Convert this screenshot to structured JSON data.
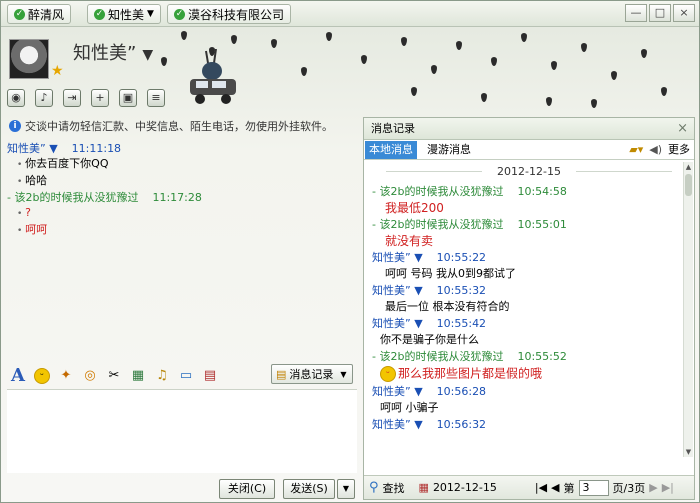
{
  "titlebar": {
    "tabs": [
      "醉清风",
      "知性美",
      "漠谷科技有限公司"
    ],
    "caret": "▼",
    "min": "—",
    "max": "□",
    "close": "×"
  },
  "header": {
    "name": "知性美”",
    "caret": "▼"
  },
  "notice": "交谈中请勿轻信汇款、中奖信息、陌生电话，勿使用外挂软件。",
  "chat": [
    {
      "type": "head",
      "sender": "知性美” ▼",
      "time": "11:11:18",
      "color": "blue"
    },
    {
      "type": "line",
      "text": "你去百度下你QQ"
    },
    {
      "type": "line",
      "text": "哈哈"
    },
    {
      "type": "head",
      "sender": "- 该2b的时候我从没犹豫过",
      "time": "11:17:28",
      "color": "green"
    },
    {
      "type": "line",
      "text": "?",
      "color": "red"
    },
    {
      "type": "line",
      "text": "呵呵",
      "color": "red"
    }
  ],
  "input_toolbar": {
    "font": "A",
    "record_label": "消息记录"
  },
  "buttons": {
    "close": "关闭(C)",
    "send": "发送(S)",
    "send_caret": "▼"
  },
  "history": {
    "title": "消息记录",
    "close": "×",
    "tabs": [
      "本地消息",
      "漫游消息"
    ],
    "more": "更多",
    "date": "2012-12-15",
    "messages": [
      {
        "sender": "- 该2b的时候我从没犹豫过",
        "time": "10:54:58",
        "color": "green",
        "body": "我最低200",
        "body_color": "red"
      },
      {
        "sender": "- 该2b的时候我从没犹豫过",
        "time": "10:55:01",
        "color": "green",
        "body": "就没有卖",
        "body_color": "red"
      },
      {
        "sender": "知性美” ▼",
        "time": "10:55:22",
        "color": "blue",
        "body": "呵呵  号码  我从0到9都试了"
      },
      {
        "sender": "知性美” ▼",
        "time": "10:55:32",
        "color": "blue",
        "body": "最后一位  根本没有符合的"
      },
      {
        "sender": "知性美” ▼",
        "time": "10:55:42",
        "color": "blue",
        "body": "你不是骗子你是什么"
      },
      {
        "sender": "- 该2b的时候我从没犹豫过",
        "time": "10:55:52",
        "color": "green",
        "body": "那么我那些图片都是假的哦",
        "body_color": "red",
        "emoji": true
      },
      {
        "sender": "知性美” ▼",
        "time": "10:56:28",
        "color": "blue",
        "body": "呵呵 小骗子"
      },
      {
        "sender": "知性美” ▼",
        "time": "10:56:32",
        "color": "blue",
        "body": ""
      }
    ],
    "footer": {
      "search": "查找",
      "date": "2012-12-15",
      "page_prefix": "第",
      "page_value": "3",
      "page_suffix": "页/3页"
    }
  }
}
